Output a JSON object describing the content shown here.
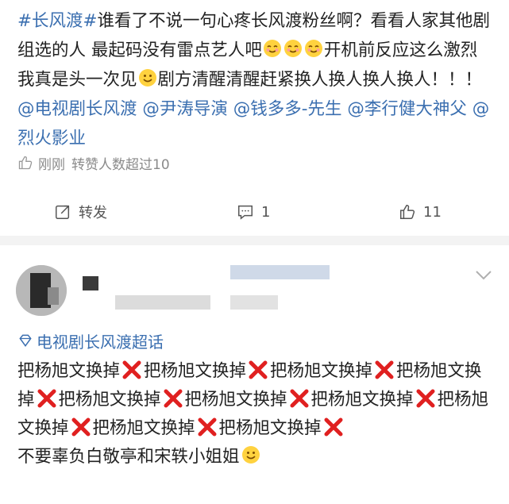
{
  "post": {
    "hashtag": "#长风渡#",
    "body": "谁看了不说一句心疼长风渡粉丝啊？看看人家其他剧组选的人 最起码没有雷点艺人吧",
    "body2": "开机前反应这么激烈我真是头一次见",
    "body3": "剧方清醒清醒赶紧换人换人换人换人！！！",
    "mentions": [
      "@电视剧长风渡",
      "@尹涛导演",
      "@钱多多-先生",
      "@李行健大神父",
      "@烈火影业"
    ],
    "meta_time": "刚刚",
    "meta_likes": "转赞人数超过10"
  },
  "actions": {
    "repost_label": "转发",
    "comment_count": "1",
    "like_count": "11"
  },
  "comment": {
    "topic": "电视剧长风渡超话",
    "repeat_text": "把杨旭文换掉",
    "repeat_count": 10,
    "last_line": "不要辜负白敬亭和宋轶小姐姐"
  },
  "colors": {
    "link": "#3b6fb0",
    "cross": "#e02020"
  }
}
